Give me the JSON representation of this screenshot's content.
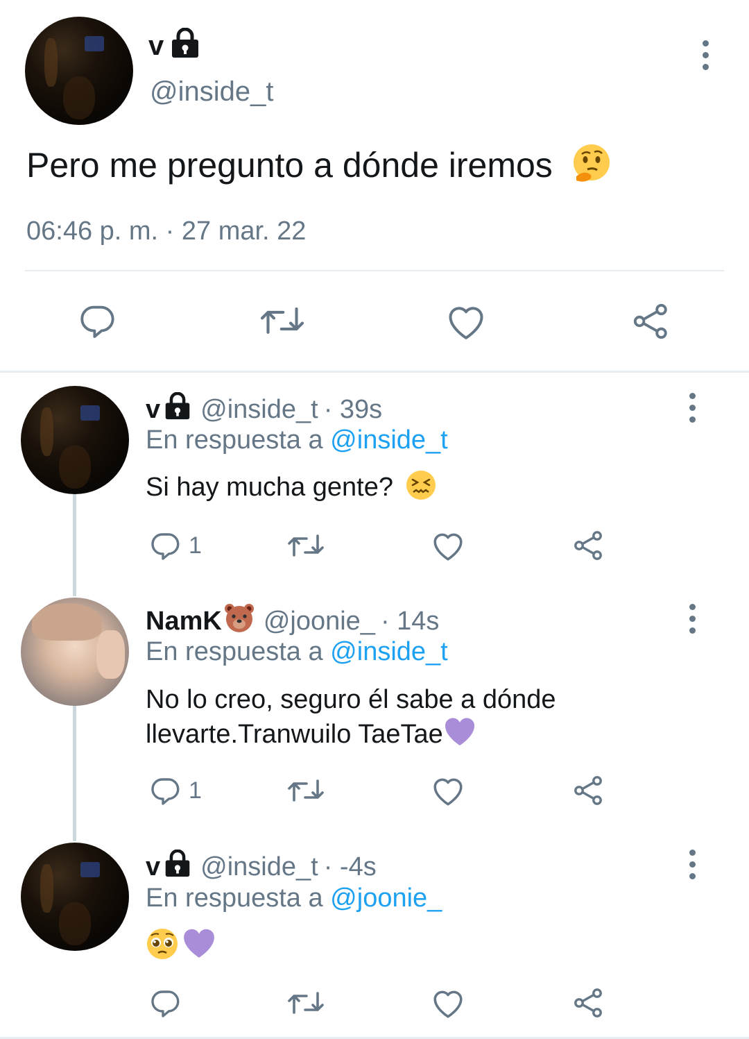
{
  "main_tweet": {
    "display_name": "v",
    "handle": "@inside_t",
    "text": "Pero me pregunto a dónde iremos",
    "emoji": "thinking-face",
    "timestamp": "06:46 p. m. · 27 mar. 22"
  },
  "replies": [
    {
      "display_name": "v",
      "handle": "@inside_t",
      "age": "· 39s",
      "reply_prefix": "En respuesta a",
      "reply_to": "@inside_t",
      "text": "Si hay mucha gente?",
      "emoji": "confounded-face",
      "reply_count": "1"
    },
    {
      "display_name": "NamK",
      "name_emoji": "bear-face",
      "handle": "@joonie_",
      "age": "· 14s",
      "reply_prefix": "En respuesta a",
      "reply_to": "@inside_t",
      "text_line1": "No lo creo, seguro él sabe a dónde",
      "text_line2": "llevarte.Tranwuilo TaeTae",
      "emoji": "purple-heart",
      "reply_count": "1"
    },
    {
      "display_name": "v",
      "handle": "@inside_t",
      "age": "· -4s",
      "reply_prefix": "En respuesta a",
      "reply_to": "@joonie_",
      "emojis": [
        "pleading-face",
        "purple-heart"
      ],
      "reply_count": ""
    }
  ],
  "colors": {
    "text": "#14171a",
    "secondary": "#657786",
    "link": "#1da1f2",
    "divider": "#e6ecf0",
    "thread_line": "#ccd6dd"
  }
}
